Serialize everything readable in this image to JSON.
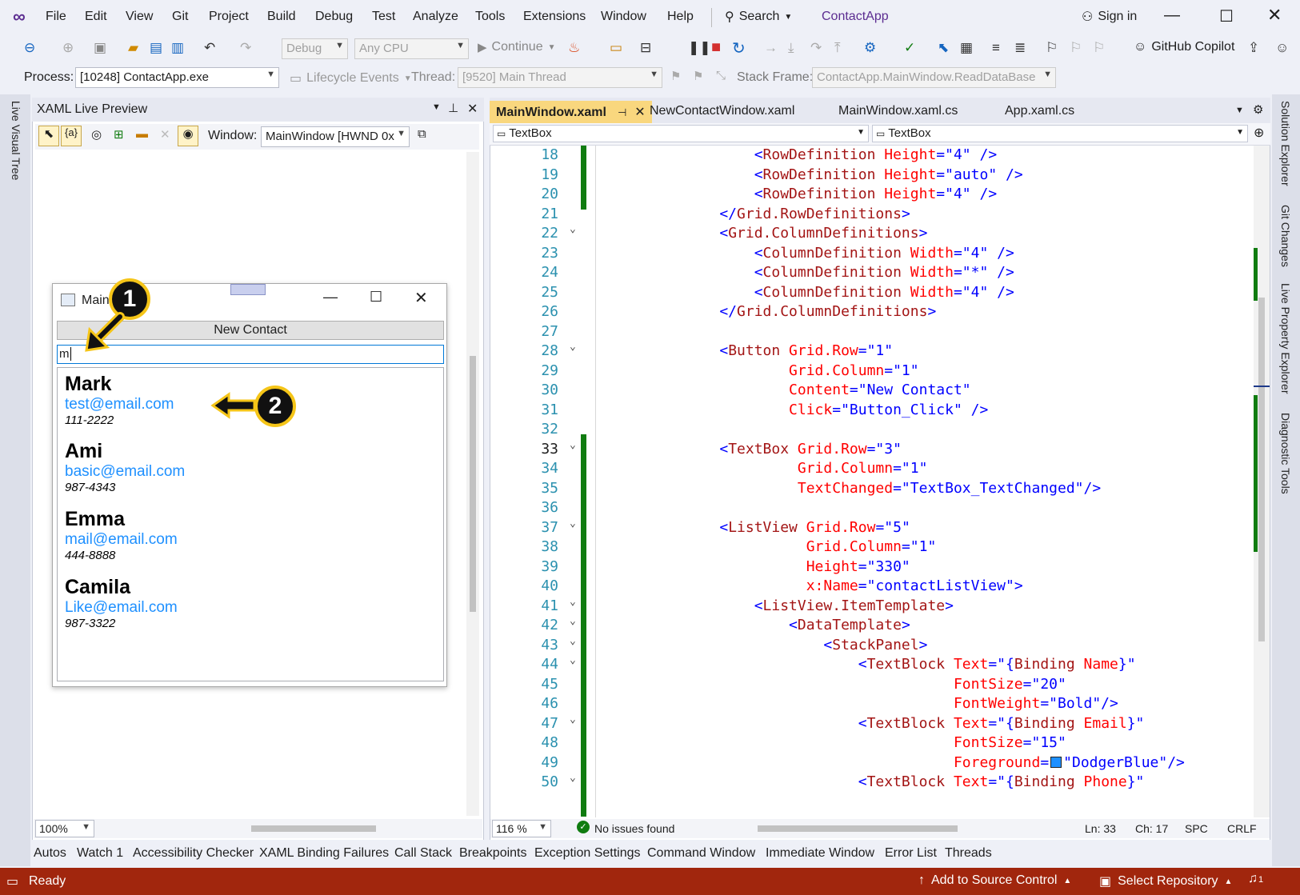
{
  "menu": [
    "File",
    "Edit",
    "View",
    "Git",
    "Project",
    "Build",
    "Debug",
    "Test",
    "Analyze",
    "Tools",
    "Extensions",
    "Window",
    "Help"
  ],
  "search_label": "Search",
  "app_title": "ContactApp",
  "sign_in": "Sign in",
  "toolbar": {
    "config": "Debug",
    "platform": "Any CPU",
    "continue": "Continue",
    "copilot": "GitHub Copilot"
  },
  "debugbar": {
    "process_label": "Process:",
    "process_value": "[10248] ContactApp.exe",
    "lifecycle": "Lifecycle Events",
    "thread_label": "Thread:",
    "thread_value": "[9520] Main Thread",
    "stackframe_label": "Stack Frame:",
    "stackframe_value": "ContactApp.MainWindow.ReadDataBase"
  },
  "left_rail": "Live Visual Tree",
  "right_rail": [
    "Solution Explorer",
    "Git Changes",
    "Live Property Explorer",
    "Diagnostic Tools"
  ],
  "preview": {
    "title": "XAML Live Preview",
    "window_label": "Window:",
    "window_value": "MainWindow [HWND 0x",
    "zoom": "100%",
    "app_window_title": "MainW",
    "new_contact": "New Contact",
    "search_text": "m",
    "contacts": [
      {
        "name": "Mark",
        "email": "test@email.com",
        "phone": "111-2222"
      },
      {
        "name": "Ami",
        "email": "basic@email.com",
        "phone": "987-4343"
      },
      {
        "name": "Emma",
        "email": "mail@email.com",
        "phone": "444-8888"
      },
      {
        "name": "Camila",
        "email": "Like@email.com",
        "phone": "987-3322"
      }
    ],
    "badge1": "1",
    "badge2": "2"
  },
  "editor": {
    "tabs": [
      "MainWindow.xaml",
      "NewContactWindow.xaml",
      "MainWindow.xaml.cs",
      "App.xaml.cs"
    ],
    "nav_left": "TextBox",
    "nav_right": "TextBox",
    "zoom": "116 %",
    "issues": "No issues found",
    "ln": "Ln: 33",
    "ch": "Ch: 17",
    "spc": "SPC",
    "crlf": "CRLF",
    "lines": [
      {
        "n": "18",
        "t": [
          [
            "tB",
            "        <"
          ],
          [
            "tN",
            "RowDefinition "
          ],
          [
            "tA",
            "Height"
          ],
          [
            "tB",
            "=\"4\" />"
          ]
        ]
      },
      {
        "n": "19",
        "t": [
          [
            "tB",
            "        <"
          ],
          [
            "tN",
            "RowDefinition "
          ],
          [
            "tA",
            "Height"
          ],
          [
            "tB",
            "=\"auto\" />"
          ]
        ]
      },
      {
        "n": "20",
        "t": [
          [
            "tB",
            "        <"
          ],
          [
            "tN",
            "RowDefinition "
          ],
          [
            "tA",
            "Height"
          ],
          [
            "tB",
            "=\"4\" />"
          ]
        ]
      },
      {
        "n": "21",
        "t": [
          [
            "tB",
            "    </"
          ],
          [
            "tN",
            "Grid.RowDefinitions"
          ],
          [
            "tB",
            ">"
          ]
        ]
      },
      {
        "n": "22",
        "t": [
          [
            "tB",
            "    <"
          ],
          [
            "tN",
            "Grid.ColumnDefinitions"
          ],
          [
            "tB",
            ">"
          ]
        ]
      },
      {
        "n": "23",
        "t": [
          [
            "tB",
            "        <"
          ],
          [
            "tN",
            "ColumnDefinition "
          ],
          [
            "tA",
            "Width"
          ],
          [
            "tB",
            "=\"4\" />"
          ]
        ]
      },
      {
        "n": "24",
        "t": [
          [
            "tB",
            "        <"
          ],
          [
            "tN",
            "ColumnDefinition "
          ],
          [
            "tA",
            "Width"
          ],
          [
            "tB",
            "=\"*\" />"
          ]
        ]
      },
      {
        "n": "25",
        "t": [
          [
            "tB",
            "        <"
          ],
          [
            "tN",
            "ColumnDefinition "
          ],
          [
            "tA",
            "Width"
          ],
          [
            "tB",
            "=\"4\" />"
          ]
        ]
      },
      {
        "n": "26",
        "t": [
          [
            "tB",
            "    </"
          ],
          [
            "tN",
            "Grid.ColumnDefinitions"
          ],
          [
            "tB",
            ">"
          ]
        ]
      },
      {
        "n": "27",
        "t": []
      },
      {
        "n": "28",
        "t": [
          [
            "tB",
            "    <"
          ],
          [
            "tN",
            "Button "
          ],
          [
            "tA",
            "Grid.Row"
          ],
          [
            "tB",
            "=\"1\""
          ]
        ]
      },
      {
        "n": "29",
        "t": [
          [
            "tA",
            "            Grid.Column"
          ],
          [
            "tB",
            "=\"1\""
          ]
        ]
      },
      {
        "n": "30",
        "t": [
          [
            "tA",
            "            Content"
          ],
          [
            "tB",
            "=\"New Contact\""
          ]
        ]
      },
      {
        "n": "31",
        "t": [
          [
            "tA",
            "            Click"
          ],
          [
            "tB",
            "=\"Button_Click\" />"
          ]
        ]
      },
      {
        "n": "32",
        "t": []
      },
      {
        "n": "33",
        "t": [
          [
            "tB",
            "    <"
          ],
          [
            "tN",
            "TextBox "
          ],
          [
            "tA",
            "Grid.Row"
          ],
          [
            "tB",
            "=\"3\""
          ]
        ]
      },
      {
        "n": "34",
        "t": [
          [
            "tA",
            "             Grid.Column"
          ],
          [
            "tB",
            "=\"1\""
          ]
        ]
      },
      {
        "n": "35",
        "t": [
          [
            "tA",
            "             TextChanged"
          ],
          [
            "tB",
            "=\"TextBox_TextChanged\"/>"
          ]
        ]
      },
      {
        "n": "36",
        "t": []
      },
      {
        "n": "37",
        "t": [
          [
            "tB",
            "    <"
          ],
          [
            "tN",
            "ListView "
          ],
          [
            "tA",
            "Grid.Row"
          ],
          [
            "tB",
            "=\"5\""
          ]
        ]
      },
      {
        "n": "38",
        "t": [
          [
            "tA",
            "              Grid.Column"
          ],
          [
            "tB",
            "=\"1\""
          ]
        ]
      },
      {
        "n": "39",
        "t": [
          [
            "tA",
            "              Height"
          ],
          [
            "tB",
            "=\"330\""
          ]
        ]
      },
      {
        "n": "40",
        "t": [
          [
            "tA",
            "              x:Name"
          ],
          [
            "tB",
            "=\"contactListView\">"
          ]
        ]
      },
      {
        "n": "41",
        "t": [
          [
            "tB",
            "        <"
          ],
          [
            "tN",
            "ListView.ItemTemplate"
          ],
          [
            "tB",
            ">"
          ]
        ]
      },
      {
        "n": "42",
        "t": [
          [
            "tB",
            "            <"
          ],
          [
            "tN",
            "DataTemplate"
          ],
          [
            "tB",
            ">"
          ]
        ]
      },
      {
        "n": "43",
        "t": [
          [
            "tB",
            "                <"
          ],
          [
            "tN",
            "StackPanel"
          ],
          [
            "tB",
            ">"
          ]
        ]
      },
      {
        "n": "44",
        "t": [
          [
            "tB",
            "                    <"
          ],
          [
            "tN",
            "TextBlock "
          ],
          [
            "tA",
            "Text"
          ],
          [
            "tB",
            "=\"{"
          ],
          [
            "tN",
            "Binding "
          ],
          [
            "tA",
            "Name"
          ],
          [
            "tB",
            "}\""
          ]
        ]
      },
      {
        "n": "45",
        "t": [
          [
            "tA",
            "                               FontSize"
          ],
          [
            "tB",
            "=\"20\""
          ]
        ]
      },
      {
        "n": "46",
        "t": [
          [
            "tA",
            "                               FontWeight"
          ],
          [
            "tB",
            "=\"Bold\"/>"
          ]
        ]
      },
      {
        "n": "47",
        "t": [
          [
            "tB",
            "                    <"
          ],
          [
            "tN",
            "TextBlock "
          ],
          [
            "tA",
            "Text"
          ],
          [
            "tB",
            "=\"{"
          ],
          [
            "tN",
            "Binding "
          ],
          [
            "tA",
            "Email"
          ],
          [
            "tB",
            "}\""
          ]
        ]
      },
      {
        "n": "48",
        "t": [
          [
            "tA",
            "                               FontSize"
          ],
          [
            "tB",
            "=\"15\""
          ]
        ]
      },
      {
        "n": "49",
        "t": [
          [
            "tA",
            "                               Foreground"
          ],
          [
            "tB",
            "="
          ],
          [
            "sw",
            ""
          ],
          [
            "tB",
            "\"DodgerBlue\"/>"
          ]
        ]
      },
      {
        "n": "50",
        "t": [
          [
            "tB",
            "                    <"
          ],
          [
            "tN",
            "TextBlock "
          ],
          [
            "tA",
            "Text"
          ],
          [
            "tB",
            "=\"{"
          ],
          [
            "tN",
            "Binding "
          ],
          [
            "tA",
            "Phone"
          ],
          [
            "tB",
            "}\""
          ]
        ]
      }
    ]
  },
  "bottom_tabs": [
    "Autos",
    "Watch 1",
    "Accessibility Checker",
    "XAML Binding Failures",
    "Call Stack",
    "Breakpoints",
    "Exception Settings",
    "Command Window",
    "Immediate Window",
    "Error List",
    "Threads"
  ],
  "status": {
    "ready": "Ready",
    "source_control": "Add to Source Control",
    "repository": "Select Repository",
    "notif": "1"
  },
  "colors": {
    "accent_tab": "#f9d77e",
    "status_bar": "#a1260d",
    "email_blue": "#1e90ff",
    "badge_border": "#f5c518"
  }
}
